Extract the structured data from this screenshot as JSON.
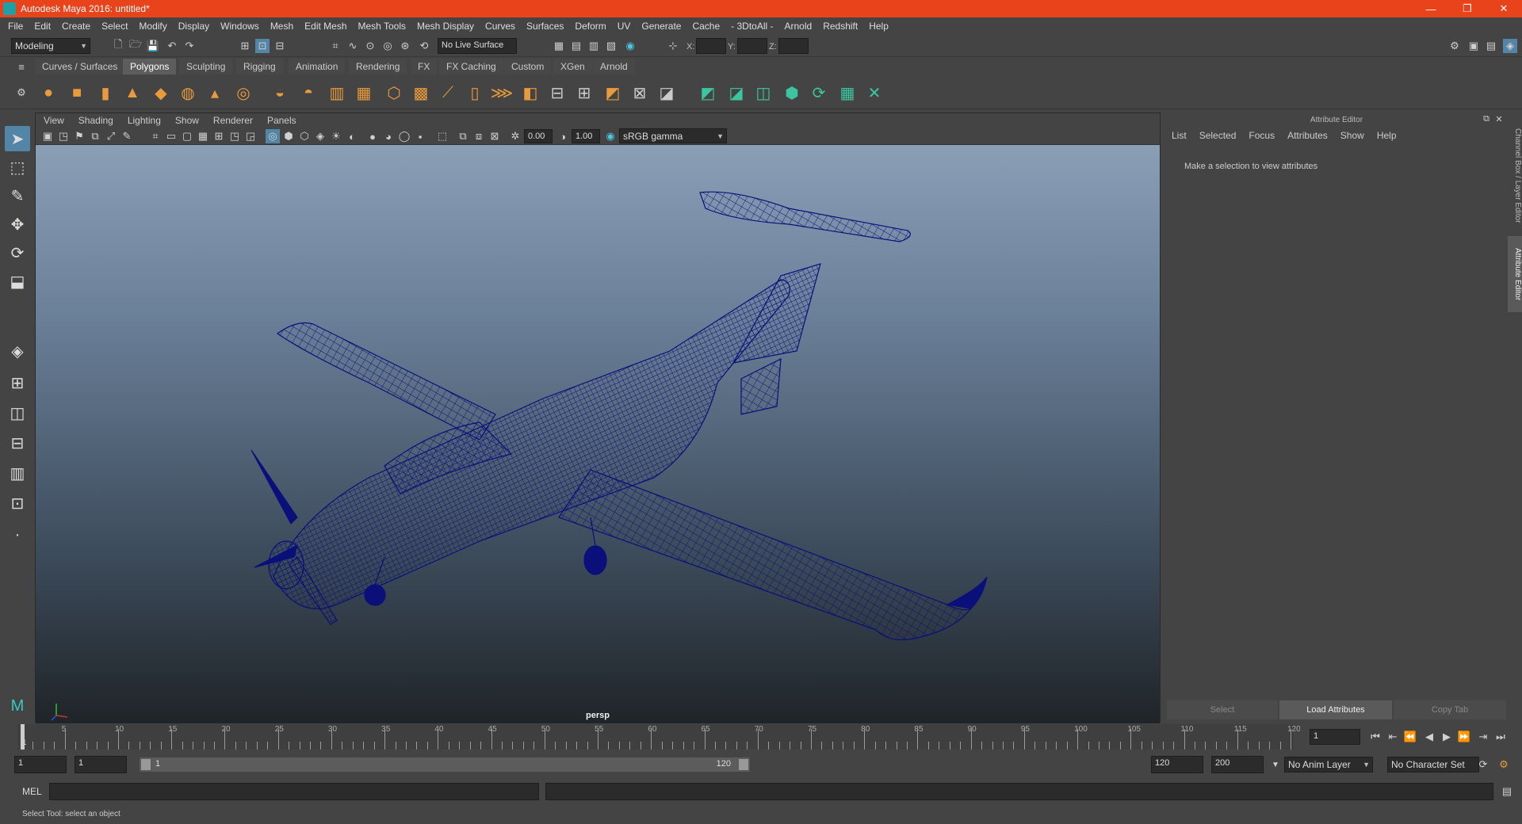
{
  "window": {
    "title": "Autodesk Maya 2016: untitled*",
    "minimize": "—",
    "maximize": "❐",
    "close": "✕"
  },
  "menubar": [
    "File",
    "Edit",
    "Create",
    "Select",
    "Modify",
    "Display",
    "Windows",
    "Mesh",
    "Edit Mesh",
    "Mesh Tools",
    "Mesh Display",
    "Curves",
    "Surfaces",
    "Deform",
    "UV",
    "Generate",
    "Cache",
    "- 3DtoAll -",
    "Arnold",
    "Redshift",
    "Help"
  ],
  "statusline": {
    "mode": "Modeling",
    "live_surface": "No Live Surface",
    "x_label": "X:",
    "y_label": "Y:",
    "z_label": "Z:"
  },
  "shelf_tabs": [
    "Curves / Surfaces",
    "Polygons",
    "Sculpting",
    "Rigging",
    "Animation",
    "Rendering",
    "FX",
    "FX Caching",
    "Custom",
    "XGen",
    "Arnold"
  ],
  "shelf_active_tab": "Polygons",
  "viewport": {
    "menu": [
      "View",
      "Shading",
      "Lighting",
      "Show",
      "Renderer",
      "Panels"
    ],
    "exposure": "0.00",
    "gamma": "1.00",
    "color_space": "sRGB gamma",
    "camera": "persp",
    "wireframe_color": "#0a0f7a"
  },
  "attribute_editor": {
    "title": "Attribute Editor",
    "menu": [
      "List",
      "Selected",
      "Focus",
      "Attributes",
      "Show",
      "Help"
    ],
    "message": "Make a selection to view attributes",
    "buttons": [
      "Select",
      "Load Attributes",
      "Copy Tab"
    ]
  },
  "side_tabs": [
    "Channel Box / Layer Editor",
    "Attribute Editor"
  ],
  "timeslider": {
    "start_mark": "1",
    "ticks": [
      "5",
      "10",
      "15",
      "20",
      "25",
      "30",
      "35",
      "40",
      "45",
      "50",
      "55",
      "60",
      "65",
      "70",
      "75",
      "80",
      "85",
      "90",
      "95",
      "100",
      "105",
      "110",
      "115",
      "120"
    ],
    "current_frame": "1"
  },
  "range": {
    "start": "1",
    "playback_start": "1",
    "slider_start": "1",
    "slider_end": "120",
    "playback_end": "120",
    "end": "200",
    "anim_layer": "No Anim Layer",
    "character_set": "No Character Set"
  },
  "cmdline": {
    "label": "MEL"
  },
  "helpline": {
    "text": "Select Tool: select an object"
  }
}
